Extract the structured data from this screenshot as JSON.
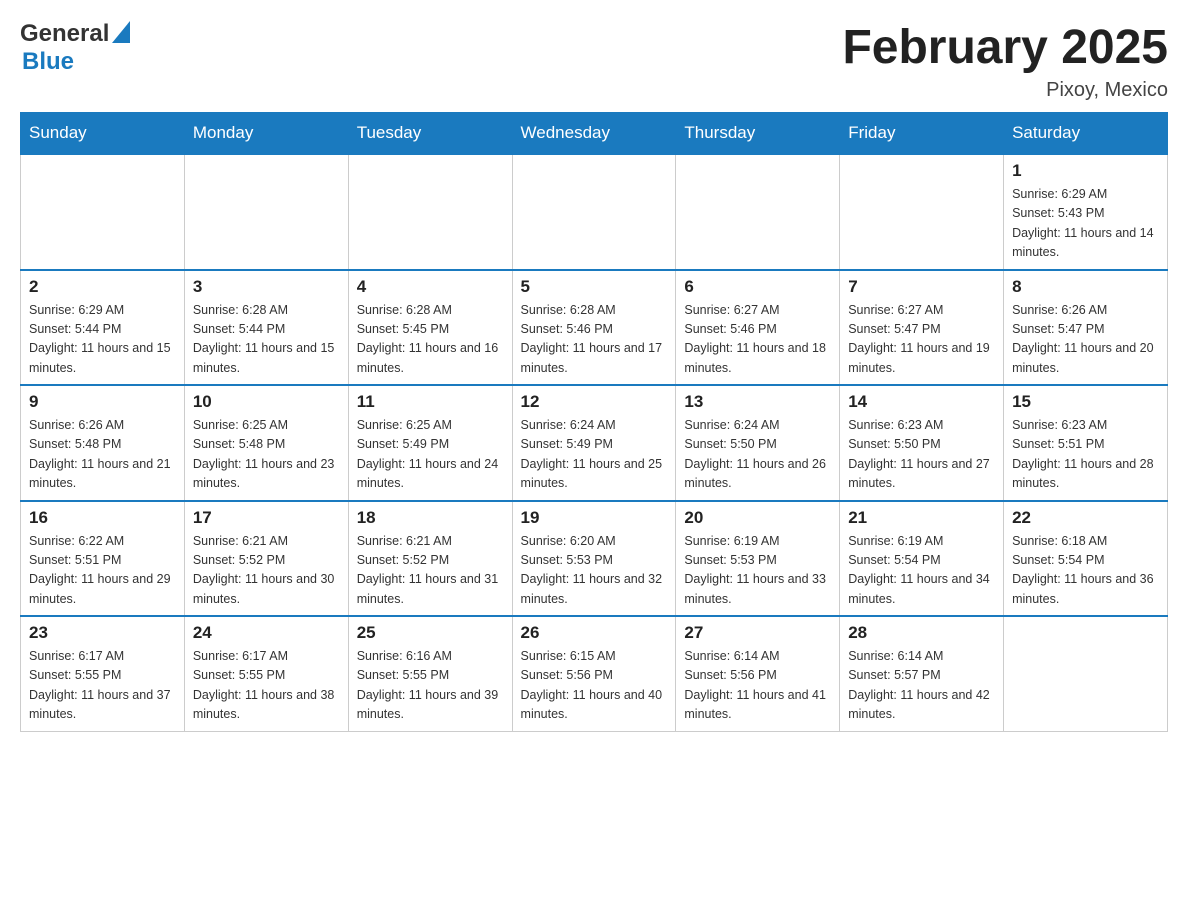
{
  "header": {
    "logo_general": "General",
    "logo_blue": "Blue",
    "month_title": "February 2025",
    "location": "Pixoy, Mexico"
  },
  "days_of_week": [
    "Sunday",
    "Monday",
    "Tuesday",
    "Wednesday",
    "Thursday",
    "Friday",
    "Saturday"
  ],
  "weeks": [
    [
      {
        "day": "",
        "sunrise": "",
        "sunset": "",
        "daylight": ""
      },
      {
        "day": "",
        "sunrise": "",
        "sunset": "",
        "daylight": ""
      },
      {
        "day": "",
        "sunrise": "",
        "sunset": "",
        "daylight": ""
      },
      {
        "day": "",
        "sunrise": "",
        "sunset": "",
        "daylight": ""
      },
      {
        "day": "",
        "sunrise": "",
        "sunset": "",
        "daylight": ""
      },
      {
        "day": "",
        "sunrise": "",
        "sunset": "",
        "daylight": ""
      },
      {
        "day": "1",
        "sunrise": "Sunrise: 6:29 AM",
        "sunset": "Sunset: 5:43 PM",
        "daylight": "Daylight: 11 hours and 14 minutes."
      }
    ],
    [
      {
        "day": "2",
        "sunrise": "Sunrise: 6:29 AM",
        "sunset": "Sunset: 5:44 PM",
        "daylight": "Daylight: 11 hours and 15 minutes."
      },
      {
        "day": "3",
        "sunrise": "Sunrise: 6:28 AM",
        "sunset": "Sunset: 5:44 PM",
        "daylight": "Daylight: 11 hours and 15 minutes."
      },
      {
        "day": "4",
        "sunrise": "Sunrise: 6:28 AM",
        "sunset": "Sunset: 5:45 PM",
        "daylight": "Daylight: 11 hours and 16 minutes."
      },
      {
        "day": "5",
        "sunrise": "Sunrise: 6:28 AM",
        "sunset": "Sunset: 5:46 PM",
        "daylight": "Daylight: 11 hours and 17 minutes."
      },
      {
        "day": "6",
        "sunrise": "Sunrise: 6:27 AM",
        "sunset": "Sunset: 5:46 PM",
        "daylight": "Daylight: 11 hours and 18 minutes."
      },
      {
        "day": "7",
        "sunrise": "Sunrise: 6:27 AM",
        "sunset": "Sunset: 5:47 PM",
        "daylight": "Daylight: 11 hours and 19 minutes."
      },
      {
        "day": "8",
        "sunrise": "Sunrise: 6:26 AM",
        "sunset": "Sunset: 5:47 PM",
        "daylight": "Daylight: 11 hours and 20 minutes."
      }
    ],
    [
      {
        "day": "9",
        "sunrise": "Sunrise: 6:26 AM",
        "sunset": "Sunset: 5:48 PM",
        "daylight": "Daylight: 11 hours and 21 minutes."
      },
      {
        "day": "10",
        "sunrise": "Sunrise: 6:25 AM",
        "sunset": "Sunset: 5:48 PM",
        "daylight": "Daylight: 11 hours and 23 minutes."
      },
      {
        "day": "11",
        "sunrise": "Sunrise: 6:25 AM",
        "sunset": "Sunset: 5:49 PM",
        "daylight": "Daylight: 11 hours and 24 minutes."
      },
      {
        "day": "12",
        "sunrise": "Sunrise: 6:24 AM",
        "sunset": "Sunset: 5:49 PM",
        "daylight": "Daylight: 11 hours and 25 minutes."
      },
      {
        "day": "13",
        "sunrise": "Sunrise: 6:24 AM",
        "sunset": "Sunset: 5:50 PM",
        "daylight": "Daylight: 11 hours and 26 minutes."
      },
      {
        "day": "14",
        "sunrise": "Sunrise: 6:23 AM",
        "sunset": "Sunset: 5:50 PM",
        "daylight": "Daylight: 11 hours and 27 minutes."
      },
      {
        "day": "15",
        "sunrise": "Sunrise: 6:23 AM",
        "sunset": "Sunset: 5:51 PM",
        "daylight": "Daylight: 11 hours and 28 minutes."
      }
    ],
    [
      {
        "day": "16",
        "sunrise": "Sunrise: 6:22 AM",
        "sunset": "Sunset: 5:51 PM",
        "daylight": "Daylight: 11 hours and 29 minutes."
      },
      {
        "day": "17",
        "sunrise": "Sunrise: 6:21 AM",
        "sunset": "Sunset: 5:52 PM",
        "daylight": "Daylight: 11 hours and 30 minutes."
      },
      {
        "day": "18",
        "sunrise": "Sunrise: 6:21 AM",
        "sunset": "Sunset: 5:52 PM",
        "daylight": "Daylight: 11 hours and 31 minutes."
      },
      {
        "day": "19",
        "sunrise": "Sunrise: 6:20 AM",
        "sunset": "Sunset: 5:53 PM",
        "daylight": "Daylight: 11 hours and 32 minutes."
      },
      {
        "day": "20",
        "sunrise": "Sunrise: 6:19 AM",
        "sunset": "Sunset: 5:53 PM",
        "daylight": "Daylight: 11 hours and 33 minutes."
      },
      {
        "day": "21",
        "sunrise": "Sunrise: 6:19 AM",
        "sunset": "Sunset: 5:54 PM",
        "daylight": "Daylight: 11 hours and 34 minutes."
      },
      {
        "day": "22",
        "sunrise": "Sunrise: 6:18 AM",
        "sunset": "Sunset: 5:54 PM",
        "daylight": "Daylight: 11 hours and 36 minutes."
      }
    ],
    [
      {
        "day": "23",
        "sunrise": "Sunrise: 6:17 AM",
        "sunset": "Sunset: 5:55 PM",
        "daylight": "Daylight: 11 hours and 37 minutes."
      },
      {
        "day": "24",
        "sunrise": "Sunrise: 6:17 AM",
        "sunset": "Sunset: 5:55 PM",
        "daylight": "Daylight: 11 hours and 38 minutes."
      },
      {
        "day": "25",
        "sunrise": "Sunrise: 6:16 AM",
        "sunset": "Sunset: 5:55 PM",
        "daylight": "Daylight: 11 hours and 39 minutes."
      },
      {
        "day": "26",
        "sunrise": "Sunrise: 6:15 AM",
        "sunset": "Sunset: 5:56 PM",
        "daylight": "Daylight: 11 hours and 40 minutes."
      },
      {
        "day": "27",
        "sunrise": "Sunrise: 6:14 AM",
        "sunset": "Sunset: 5:56 PM",
        "daylight": "Daylight: 11 hours and 41 minutes."
      },
      {
        "day": "28",
        "sunrise": "Sunrise: 6:14 AM",
        "sunset": "Sunset: 5:57 PM",
        "daylight": "Daylight: 11 hours and 42 minutes."
      },
      {
        "day": "",
        "sunrise": "",
        "sunset": "",
        "daylight": ""
      }
    ]
  ]
}
